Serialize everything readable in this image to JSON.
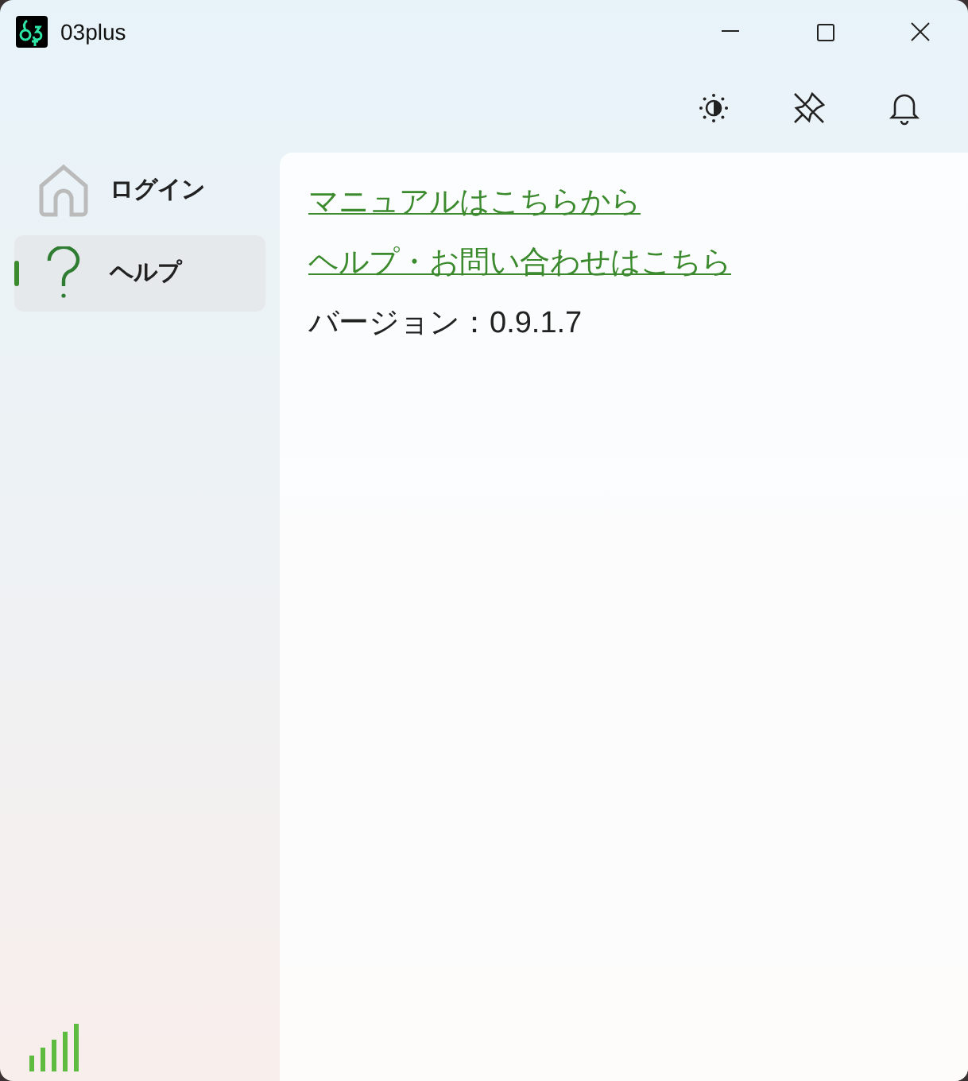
{
  "window": {
    "title": "03plus"
  },
  "nav": {
    "items": [
      {
        "label": "ログイン",
        "kind": "home",
        "selected": false
      },
      {
        "label": "ヘルプ",
        "kind": "help",
        "selected": true
      }
    ]
  },
  "content": {
    "links": [
      "マニュアルはこちらから",
      "ヘルプ・お問い合わせはこちら"
    ],
    "version": "バージョン：0.9.1.7"
  }
}
